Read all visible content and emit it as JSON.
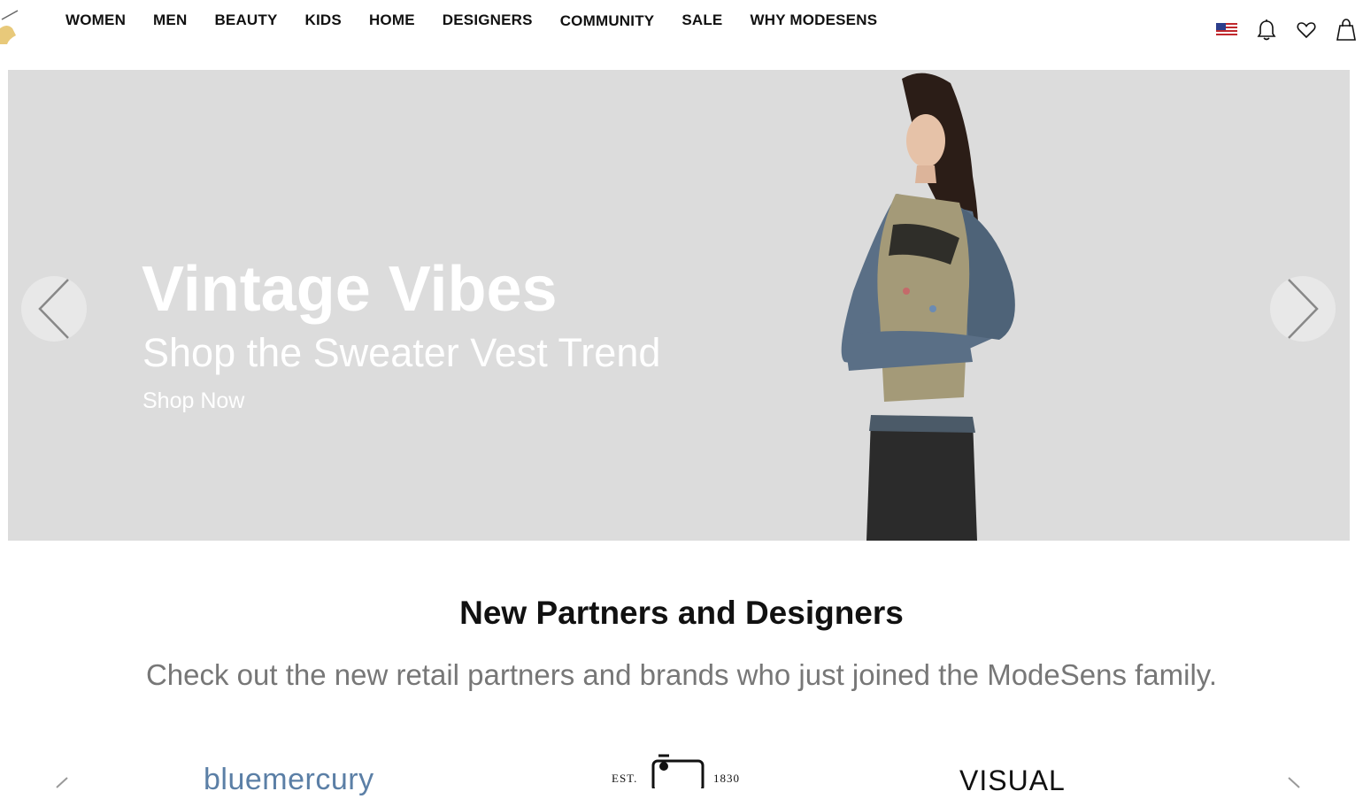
{
  "nav": {
    "items": [
      {
        "label": "WOMEN"
      },
      {
        "label": "MEN"
      },
      {
        "label": "BEAUTY"
      },
      {
        "label": "KIDS"
      },
      {
        "label": "HOME"
      },
      {
        "label": "DESIGNERS"
      },
      {
        "label": "COMMUNITY"
      },
      {
        "label": "SALE"
      },
      {
        "label": "WHY MODESENS"
      }
    ]
  },
  "header_icons": [
    "us-flag-icon",
    "bell-icon",
    "heart-icon",
    "shopping-bag-icon"
  ],
  "hero": {
    "title": "Vintage Vibes",
    "subtitle": "Shop the Sweater Vest Trend",
    "cta": "Shop Now",
    "background_color": "#dcdcdc"
  },
  "partners": {
    "title": "New Partners and Designers",
    "description": "Check out the new retail partners and brands who just joined the ModeSens family.",
    "logos": [
      {
        "text": "bluemercury"
      },
      {
        "text_left": "EST.",
        "text_right": "1830"
      },
      {
        "text": "VISUAL MOOD"
      }
    ]
  }
}
